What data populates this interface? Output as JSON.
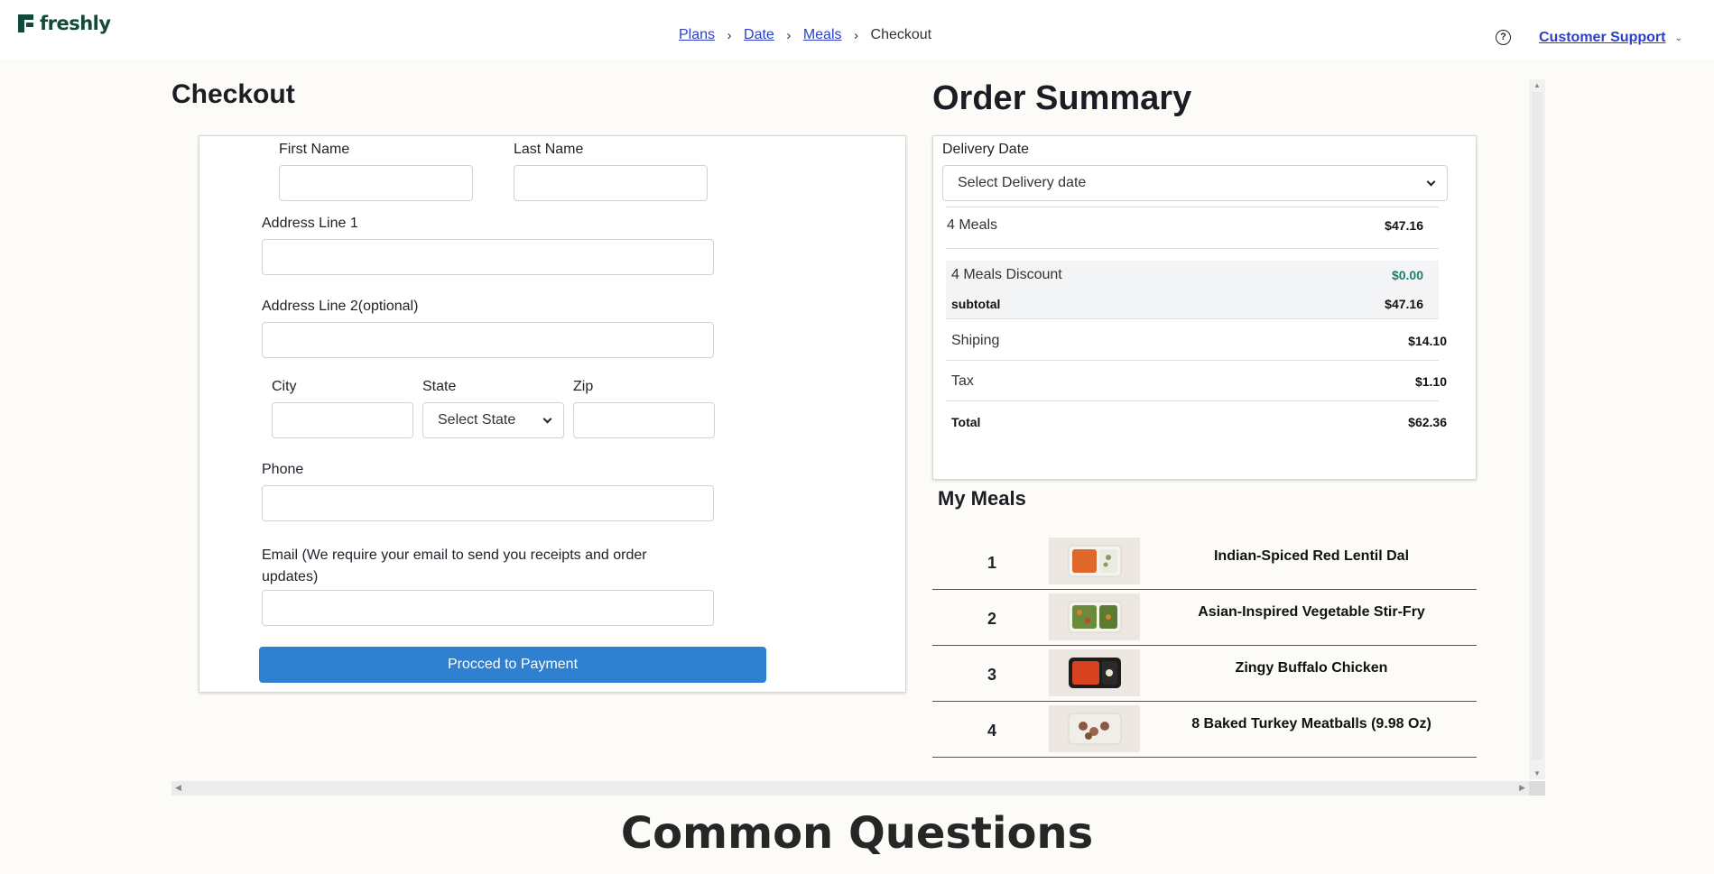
{
  "brand": {
    "name": "freshly",
    "color": "#0f4a3a"
  },
  "breadcrumb": {
    "items": [
      "Plans",
      "Date",
      "Meals"
    ],
    "current": "Checkout",
    "separator": "›"
  },
  "header": {
    "help_icon_glyph": "?",
    "support_label": "Customer Support",
    "support_chevron": "⌄"
  },
  "checkout": {
    "title": "Checkout",
    "fields": {
      "first_name": "First Name",
      "last_name": "Last Name",
      "address1": "Address Line 1",
      "address2": "Address Line 2(optional)",
      "city": "City",
      "state": "State",
      "state_placeholder": "Select State",
      "zip": "Zip",
      "phone": "Phone",
      "email": "Email (We require your email to send you receipts and order updates)"
    },
    "submit_label": "Procced to Payment",
    "accent": "#2f80d0"
  },
  "summary": {
    "title": "Order Summary",
    "delivery_label": "Delivery Date",
    "delivery_placeholder": "Select Delivery date",
    "meals_label": "4 Meals",
    "meals_price": "$47.16",
    "discount_label": "4 Meals Discount",
    "discount_value": "$0.00",
    "discount_color": "#1a7f6e",
    "subtotal_label": "subtotal",
    "subtotal_value": "$47.16",
    "shipping_label": "Shiping",
    "shipping_value": "$14.10",
    "tax_label": "Tax",
    "tax_value": "$1.10",
    "total_label": "Total",
    "total_value": "$62.36"
  },
  "my_meals": {
    "title": "My Meals",
    "items": [
      {
        "num": "1",
        "name": "Indian-Spiced Red Lentil Dal"
      },
      {
        "num": "2",
        "name": "Asian-Inspired Vegetable Stir-Fry"
      },
      {
        "num": "3",
        "name": "Zingy Buffalo Chicken"
      },
      {
        "num": "4",
        "name": "8 Baked Turkey Meatballs (9.98 Oz)"
      }
    ]
  },
  "faq": {
    "title": "Common Questions"
  }
}
